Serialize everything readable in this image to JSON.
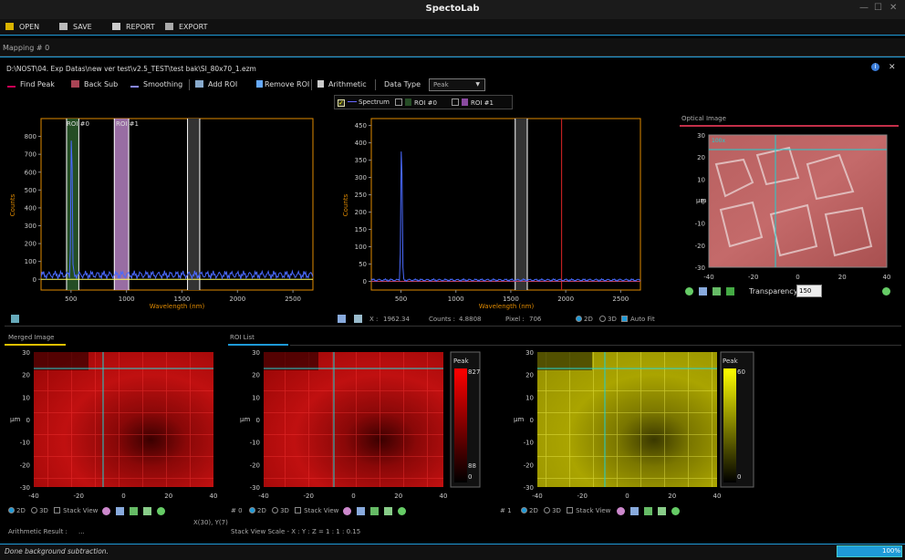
{
  "app": {
    "title": "SpectoLab"
  },
  "menu": {
    "open": "OPEN",
    "save": "SAVE",
    "report": "REPORT",
    "export": "EXPORT"
  },
  "tab": {
    "label": "Mapping # 0"
  },
  "file_path": "D:\\NOST\\04. Exp Datas\\new ver test\\v2.5_TEST\\test bak\\SI_80x70_1.ezm",
  "toolbar": {
    "find_peak": "Find Peak",
    "back_sub": "Back Sub",
    "smoothing": "Smoothing",
    "add_roi": "Add ROI",
    "remove_roi": "Remove ROI",
    "arithmetic": "Arithmetic",
    "data_type_label": "Data Type",
    "data_type_value": "Peak"
  },
  "legend": {
    "spectrum": "Spectrum",
    "roi0": "ROI #0",
    "roi1": "ROI #1"
  },
  "chart1": {
    "roi_label_0": "ROI #0",
    "roi_label_1": "ROI #1"
  },
  "optical": {
    "title": "Optical Image",
    "magnification": "100x",
    "transparency_label": "Transparency",
    "transparency_value": "150"
  },
  "info_row": {
    "x_label": "X :",
    "x_value": "1962.34",
    "counts_label": "Counts :",
    "counts_value": "4.8808",
    "pixel_label": "Pixel :",
    "pixel_value": "706",
    "opt_2d": "2D",
    "opt_3d": "3D",
    "autofit": "Auto Fit"
  },
  "merged": {
    "title": "Merged Image",
    "coord": "X(30), Y(7)",
    "arith_label": "Arithmetic Result :",
    "arith_value": "..."
  },
  "roilist": {
    "title": "ROI List",
    "stack_scale": "Stack View Scale - X : Y : Z = 1 : 1 : 0.15"
  },
  "panels": [
    {
      "index": "",
      "colorbar_title": "",
      "cb_max": "",
      "cb_min": "",
      "cb_max2": ""
    },
    {
      "index": "# 0",
      "colorbar_title": "Peak",
      "cb_max": "827",
      "cb_mid": "88",
      "cb_min": "0"
    },
    {
      "index": "# 1",
      "colorbar_title": "Peak",
      "cb_max": "60",
      "cb_min": "0"
    }
  ],
  "view_opts": {
    "d2": "2D",
    "d3": "3D",
    "stack": "Stack View"
  },
  "status": {
    "message": "Done background subtraction.",
    "progress": "100%"
  },
  "chart_data": [
    {
      "type": "line",
      "ylabel": "Counts",
      "xlabel": "Wavelength (nm)",
      "xticks": [
        500,
        1000,
        1500,
        2000,
        2500
      ],
      "yticks": [
        0,
        100,
        200,
        300,
        400,
        500,
        600,
        700,
        800
      ],
      "xlim": [
        230,
        2680
      ],
      "ylim": [
        -60,
        900
      ],
      "series": [
        {
          "peak_x": 505,
          "peak_y": 880
        }
      ],
      "bands": [
        {
          "name": "ROI #0",
          "x0": 460,
          "x1": 570,
          "color": "#2a5a2a"
        },
        {
          "name": "ROI #1",
          "x0": 890,
          "x1": 1020,
          "color": "#b380c0"
        }
      ]
    },
    {
      "type": "line",
      "ylabel": "Counts",
      "xlabel": "Wavelength (nm)",
      "xticks": [
        500,
        1000,
        1500,
        2000,
        2500
      ],
      "yticks": [
        0,
        50,
        100,
        150,
        200,
        250,
        300,
        350,
        400,
        450
      ],
      "xlim": [
        230,
        2680
      ],
      "ylim": [
        -25,
        470
      ],
      "series": [
        {
          "peak_x": 505,
          "peak_y": 425
        }
      ]
    }
  ],
  "colors": {
    "accent": "#1e9ad8",
    "axis_orange": "#e08a00",
    "cursor": "#1fd0d0",
    "red_map": "#cc1010",
    "yellow_map": "#c8c200"
  }
}
